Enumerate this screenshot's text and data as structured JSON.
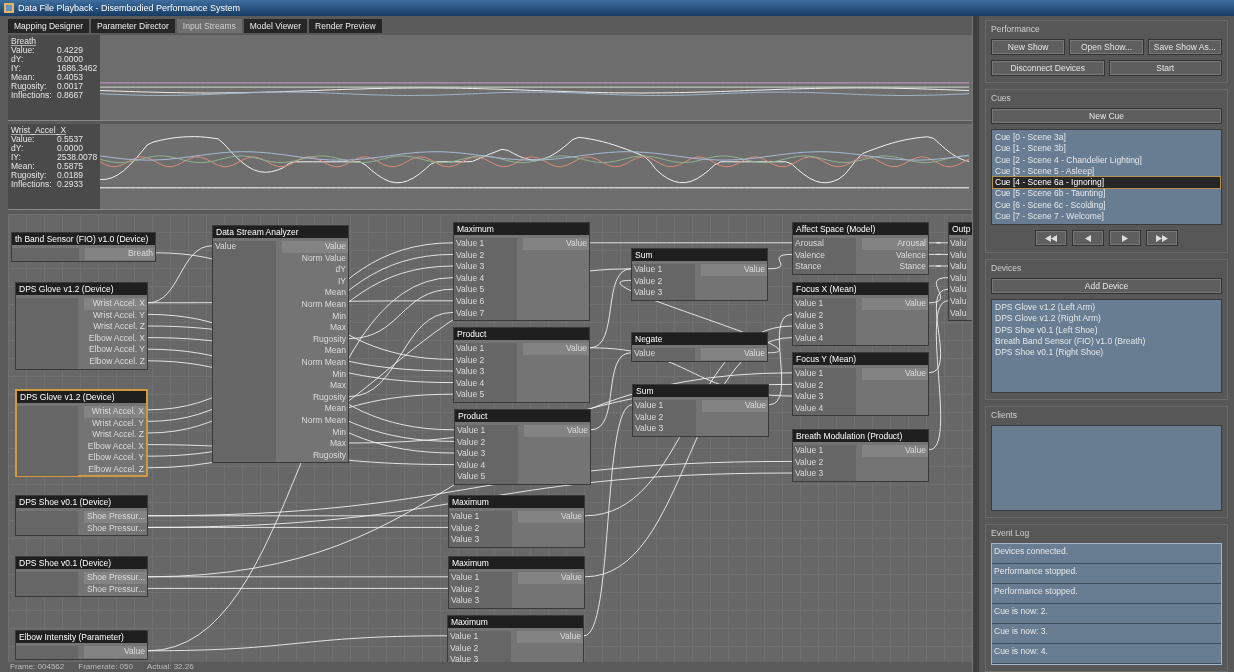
{
  "window": {
    "title": "Data File Playback - Disembodied Performance System"
  },
  "tabs": [
    {
      "label": "Mapping Designer",
      "selected": false
    },
    {
      "label": "Parameter Director",
      "selected": false
    },
    {
      "label": "Input Streams",
      "selected": true
    },
    {
      "label": "Model Viewer",
      "selected": false
    },
    {
      "label": "Render Preview",
      "selected": false
    }
  ],
  "streams": [
    {
      "name": "Breath",
      "stats": [
        {
          "label": "Value:",
          "value": "0.4229"
        },
        {
          "label": "dY:",
          "value": "0.0000"
        },
        {
          "label": "IY:",
          "value": "1686.3462"
        },
        {
          "label": "Mean:",
          "value": "0.4053"
        },
        {
          "label": "Rugosity:",
          "value": "0.0017"
        },
        {
          "label": "Inflections:",
          "value": "0.8667"
        }
      ]
    },
    {
      "name": "Wrist_Accel_X",
      "stats": [
        {
          "label": "Value:",
          "value": "0.5537"
        },
        {
          "label": "dY:",
          "value": "0.0000"
        },
        {
          "label": "IY:",
          "value": "2538.0078"
        },
        {
          "label": "Mean:",
          "value": "0.5875"
        },
        {
          "label": "Rugosity:",
          "value": "0.0189"
        },
        {
          "label": "Inflections:",
          "value": "0.2933"
        }
      ]
    }
  ],
  "nodes": [
    {
      "title": "th Band Sensor (FIO) v1.0 (Device)",
      "selected": false,
      "outputs": [
        "Breath"
      ]
    },
    {
      "title": "DPS Glove v1.2 (Device)",
      "selected": false,
      "outputs": [
        "Wrist Accel. X",
        "Wrist Accel. Y",
        "Wrist Accel. Z",
        "Elbow Accel. X",
        "Elbow Accel. Y",
        "Elbow Accel. Z"
      ]
    },
    {
      "title": "DPS Glove v1.2 (Device)",
      "selected": true,
      "outputs": [
        "Wrist Accel. X",
        "Wrist Accel. Y",
        "Wrist Accel. Z",
        "Elbow Accel. X",
        "Elbow Accel. Y",
        "Elbow Accel. Z"
      ]
    },
    {
      "title": "DPS Shoe v0.1 (Device)",
      "selected": false,
      "outputs": [
        "Shoe Pressur...",
        "Shoe Pressur..."
      ]
    },
    {
      "title": "DPS Shoe v0.1 (Device)",
      "selected": false,
      "outputs": [
        "Shoe Pressur...",
        "Shoe Pressur..."
      ]
    },
    {
      "title": "Elbow Intensity (Parameter)",
      "selected": false,
      "outputs": [
        "Value"
      ]
    },
    {
      "title": "Data Stream Analyzer",
      "selected": false,
      "inputs": [
        "Value"
      ],
      "outputs": [
        "Value",
        "Norm Value",
        "dY",
        "IY",
        "Mean",
        "Norm Mean",
        "Min",
        "Max",
        "Rugosity",
        "Mean",
        "Norm Mean",
        "Min",
        "Max",
        "Rugosity",
        "Mean",
        "Norm Mean",
        "Min",
        "Max",
        "Rugosity"
      ]
    },
    {
      "title": "Maximum",
      "selected": false,
      "inputs": [
        "Value 1",
        "Value 2",
        "Value 3",
        "Value 4",
        "Value 5",
        "Value 6",
        "Value 7"
      ],
      "outputs": [
        "Value"
      ]
    },
    {
      "title": "Product",
      "selected": false,
      "inputs": [
        "Value 1",
        "Value 2",
        "Value 3",
        "Value 4",
        "Value 5"
      ],
      "outputs": [
        "Value"
      ]
    },
    {
      "title": "Product",
      "selected": false,
      "inputs": [
        "Value 1",
        "Value 2",
        "Value 3",
        "Value 4",
        "Value 5"
      ],
      "outputs": [
        "Value"
      ]
    },
    {
      "title": "Maximum",
      "selected": false,
      "inputs": [
        "Value 1",
        "Value 2",
        "Value 3"
      ],
      "outputs": [
        "Value"
      ]
    },
    {
      "title": "Maximum",
      "selected": false,
      "inputs": [
        "Value 1",
        "Value 2",
        "Value 3"
      ],
      "outputs": [
        "Value"
      ]
    },
    {
      "title": "Maximum",
      "selected": false,
      "inputs": [
        "Value 1",
        "Value 2",
        "Value 3"
      ],
      "outputs": [
        "Value"
      ]
    },
    {
      "title": "Sum",
      "selected": false,
      "inputs": [
        "Value 1",
        "Value 2",
        "Value 3"
      ],
      "outputs": [
        "Value"
      ]
    },
    {
      "title": "Negate",
      "selected": false,
      "inputs": [
        "Value"
      ],
      "outputs": [
        "Value"
      ]
    },
    {
      "title": "Sum",
      "selected": false,
      "inputs": [
        "Value 1",
        "Value 2",
        "Value 3"
      ],
      "outputs": [
        "Value"
      ]
    },
    {
      "title": "Affect Space (Model)",
      "selected": false,
      "inputs": [
        "Arousal",
        "Valence",
        "Stance"
      ],
      "outputs": [
        "Arousal",
        "Valence",
        "Stance"
      ]
    },
    {
      "title": "Focus X (Mean)",
      "selected": false,
      "inputs": [
        "Value 1",
        "Value 2",
        "Value 3",
        "Value 4"
      ],
      "outputs": [
        "Value"
      ]
    },
    {
      "title": "Focus Y (Mean)",
      "selected": false,
      "inputs": [
        "Value 1",
        "Value 2",
        "Value 3",
        "Value 4"
      ],
      "outputs": [
        "Value"
      ]
    },
    {
      "title": "Breath Modulation (Product)",
      "selected": false,
      "inputs": [
        "Value 1",
        "Value 2",
        "Value 3"
      ],
      "outputs": [
        "Value"
      ]
    },
    {
      "title": "Outp",
      "selected": false,
      "inputs": [
        "Valu",
        "Valu",
        "Valu",
        "Valu",
        "Valu",
        "Valu",
        "Valu"
      ]
    }
  ],
  "status_bar": {
    "frame": "Frame: 004562",
    "framerate": "Framerate: 050",
    "actual": "Actual: 32.26"
  },
  "performance": {
    "title": "Performance",
    "buttons": [
      "New Show",
      "Open Show...",
      "Save Show As..."
    ],
    "buttons_row2": [
      "Disconnect Devices",
      "Start"
    ]
  },
  "cues": {
    "title": "Cues",
    "button": "New Cue",
    "items": [
      {
        "label": "Cue [0 - Scene 3a]",
        "selected": false
      },
      {
        "label": "Cue [1 - Scene 3b]",
        "selected": false
      },
      {
        "label": "Cue [2 - Scene 4 - Chandelier Lighting]",
        "selected": false
      },
      {
        "label": "Cue [3 - Scene 5 - Asleep]",
        "selected": false
      },
      {
        "label": "Cue [4 - Scene 6a - Ignoring]",
        "selected": true
      },
      {
        "label": "Cue [5 - Scene 6b - Taunting]",
        "selected": false
      },
      {
        "label": "Cue [6 - Scene 6c - Scolding]",
        "selected": false
      },
      {
        "label": "Cue [7 - Scene 7 - Welcome]",
        "selected": false
      }
    ]
  },
  "devices": {
    "title": "Devices",
    "button": "Add Device",
    "items": [
      "DPS Glove v1.2 (Left Arm)",
      "DPS Glove v1.2 (Right Arm)",
      "DPS Shoe v0.1 (Left Shoe)",
      "Breath Band Sensor (FIO) v1.0 (Breath)",
      "DPS Shoe v0.1 (Right Shoe)"
    ]
  },
  "clients": {
    "title": "Clients"
  },
  "event_log": {
    "title": "Event Log",
    "entries": [
      "Devices connected.",
      "Performance stopped.",
      "Performance stopped.",
      "Cue is now: 2.",
      "Cue is now: 3.",
      "Cue is now: 4."
    ]
  }
}
